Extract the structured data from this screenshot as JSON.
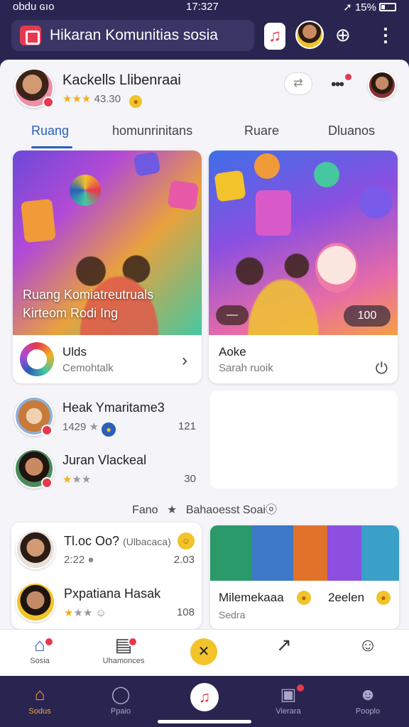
{
  "status": {
    "left": "obdu ɢıo",
    "time": "17:327",
    "battery": "15%"
  },
  "header": {
    "title": "Hikaran Komunitias sosia"
  },
  "profile": {
    "name": "Kackells Llibenraai",
    "stars": "★★★",
    "rating": "43.30"
  },
  "tabs": [
    "Ruang",
    "homunrinitans",
    "Ruare",
    "Dluanos"
  ],
  "cards": {
    "a": {
      "caption_line1": "Ruang Komiatreutruals",
      "caption_line2": "Kirteom Rodi Ing",
      "title": "Ulds",
      "subtitle": "Cemohtalk"
    },
    "b": {
      "pill": "—",
      "count": "100",
      "title": "Aoke",
      "subtitle": "Sarah ruoik"
    }
  },
  "list": [
    {
      "name": "Heak Ymaritame3",
      "meta": "1429",
      "count": "121"
    },
    {
      "name": "Juran Vlackeal",
      "meta": "",
      "count": "30"
    }
  ],
  "section_label": {
    "left": "Fano",
    "right": "Bahaoesst Soaiⓞ"
  },
  "card3": {
    "rows": [
      {
        "name": "Tl.oc Oo?",
        "tag": "(Ulbacaca)",
        "meta": "2:22",
        "count": "2.03"
      },
      {
        "name": "Pxpatiana Hasak",
        "meta": "",
        "count": "108"
      }
    ]
  },
  "card4": {
    "left_title": "Milemekaaa",
    "left_sub": "Sedra",
    "right_title": "2eelen"
  },
  "tabbar2": {
    "items": [
      "Sosia",
      "Uhamonces"
    ]
  },
  "bottom_nav": {
    "items": [
      "Sodus",
      "Ppaio",
      "",
      "Vierara",
      "Pooplo"
    ]
  },
  "colors": {
    "nav_bg": "#2a2450",
    "accent_blue": "#2960b8",
    "accent_red": "#e53950",
    "accent_orange": "#f2a23a"
  }
}
